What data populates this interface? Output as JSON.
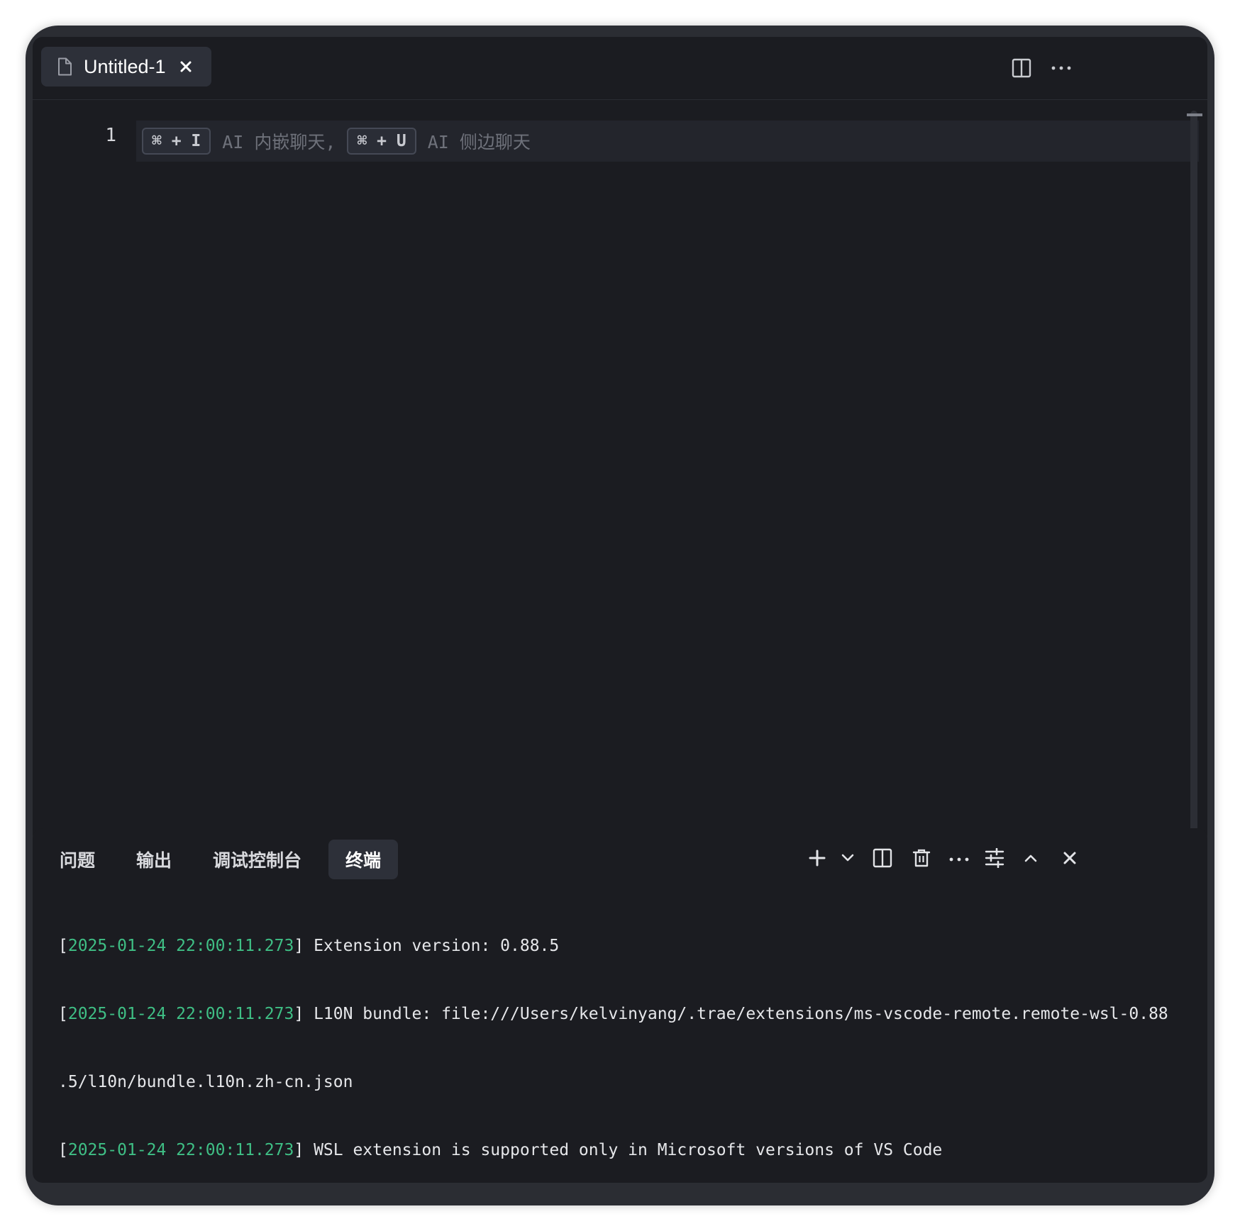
{
  "editor": {
    "tab": {
      "title": "Untitled-1"
    },
    "line_numbers": [
      "1"
    ],
    "hint": {
      "inline_shortcut": "⌘ + I",
      "inline_text": "AI 内嵌聊天,",
      "side_shortcut": "⌘ + U",
      "side_text": "AI 侧边聊天"
    },
    "toolbar_icons": [
      "split-editor-icon",
      "more-icon"
    ]
  },
  "panel": {
    "tabs": [
      {
        "label": "问题",
        "active": false
      },
      {
        "label": "输出",
        "active": false
      },
      {
        "label": "调试控制台",
        "active": false
      },
      {
        "label": "终端",
        "active": true
      }
    ],
    "actions": [
      "plus-icon",
      "chevron-down-icon",
      "split-terminal-icon",
      "trash-icon",
      "more-icon",
      "tune-icon",
      "chevron-up-icon",
      "close-icon"
    ],
    "terminal": {
      "lines": [
        {
          "ts": "2025-01-24 22:00:11.273",
          "msg": "Extension version: 0.88.5"
        },
        {
          "ts": "2025-01-24 22:00:11.273",
          "msg": "L10N bundle: file:///Users/kelvinyang/.trae/extensions/ms-vscode-remote.remote-wsl-0.88"
        },
        {
          "ts": "",
          "msg": ".5/l10n/bundle.l10n.zh-cn.json"
        },
        {
          "ts": "2025-01-24 22:00:11.273",
          "msg": "WSL extension is supported only in Microsoft versions of VS Code"
        }
      ]
    }
  },
  "colors": {
    "editor_bg": "#1b1c21",
    "window_frame": "#2b2d33",
    "tab_active_bg": "#2d3039",
    "timestamp_green": "#3fbf85",
    "hint_gray": "#6e717a"
  }
}
